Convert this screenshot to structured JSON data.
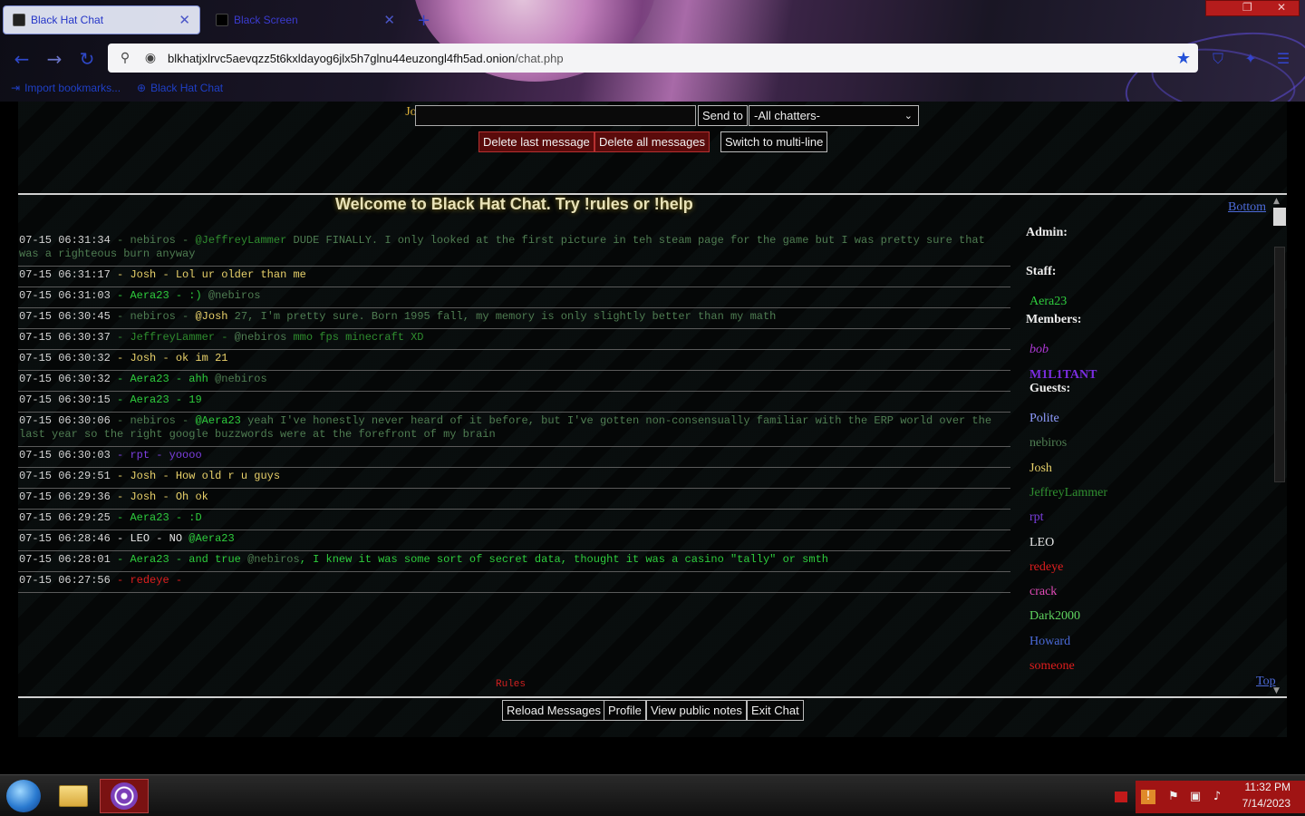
{
  "browser": {
    "tabs": [
      {
        "label": "Black Hat Chat",
        "active": true
      },
      {
        "label": "Black Screen",
        "active": false
      }
    ],
    "url": {
      "host": "blkhatjxlrvc5aevqzz5t6kxldayog6jlx5h7glnu44euzongl4fh5ad.onion",
      "path": "/chat.php"
    },
    "bookmarks": [
      "Import bookmarks...",
      "Black Hat Chat"
    ]
  },
  "chat_form": {
    "nickname": "Josh",
    "send_label": "Send to",
    "recipient": "-All chatters-",
    "delete_last_label": "Delete last message",
    "delete_all_label": "Delete all messages",
    "multiline_label": "Switch to multi-line"
  },
  "welcome": "Welcome to Black Hat Chat. Try !rules or !help",
  "nav": {
    "bottom": "Bottom",
    "top": "Top",
    "rules": "Rules"
  },
  "colors": {
    "nebiros": "#4f7d52",
    "Josh": "#e8d16a",
    "Aera23": "#2ecc3d",
    "JeffreyLammer": "#2f8d2f",
    "rpt": "#7c3fe0",
    "LEO": "#e6e6e6",
    "redeye": "#e01e1e"
  },
  "messages": [
    {
      "time": "07-15 06:31:34",
      "user": "nebiros",
      "segments": [
        {
          "t": "@JeffreyLammer",
          "c": "JeffreyLammer"
        },
        {
          "t": " DUDE FINALLY. I only looked at the first picture in teh steam page for the game but I was pretty sure that was a righteous burn anyway",
          "c": "nebiros"
        }
      ]
    },
    {
      "time": "07-15 06:31:17",
      "user": "Josh",
      "segments": [
        {
          "t": "Lol ur older than me",
          "c": "Josh"
        }
      ]
    },
    {
      "time": "07-15 06:31:03",
      "user": "Aera23",
      "segments": [
        {
          "t": ":) ",
          "c": "Aera23"
        },
        {
          "t": "@nebiros",
          "c": "nebiros"
        }
      ]
    },
    {
      "time": "07-15 06:30:45",
      "user": "nebiros",
      "segments": [
        {
          "t": "@Josh",
          "c": "Josh"
        },
        {
          "t": " 27, I'm pretty sure. Born 1995 fall, my memory is only slightly better than my math",
          "c": "nebiros"
        }
      ]
    },
    {
      "time": "07-15 06:30:37",
      "user": "JeffreyLammer",
      "segments": [
        {
          "t": "@nebiros",
          "c": "nebiros"
        },
        {
          "t": " mmo fps minecraft XD",
          "c": "JeffreyLammer"
        }
      ]
    },
    {
      "time": "07-15 06:30:32",
      "user": "Josh",
      "segments": [
        {
          "t": "ok im 21",
          "c": "Josh"
        }
      ]
    },
    {
      "time": "07-15 06:30:32",
      "user": "Aera23",
      "segments": [
        {
          "t": "ahh ",
          "c": "Aera23"
        },
        {
          "t": "@nebiros",
          "c": "nebiros"
        }
      ]
    },
    {
      "time": "07-15 06:30:15",
      "user": "Aera23",
      "segments": [
        {
          "t": "19",
          "c": "Aera23"
        }
      ]
    },
    {
      "time": "07-15 06:30:06",
      "user": "nebiros",
      "segments": [
        {
          "t": "@Aera23",
          "c": "Aera23"
        },
        {
          "t": " yeah I've honestly never heard of it before, but I've gotten non-consensually familiar with the ERP world over the last year so the right google buzzwords were at the forefront of my brain",
          "c": "nebiros"
        }
      ]
    },
    {
      "time": "07-15 06:30:03",
      "user": "rpt",
      "segments": [
        {
          "t": "yoooo",
          "c": "rpt"
        }
      ]
    },
    {
      "time": "07-15 06:29:51",
      "user": "Josh",
      "segments": [
        {
          "t": "How old r u guys",
          "c": "Josh"
        }
      ]
    },
    {
      "time": "07-15 06:29:36",
      "user": "Josh",
      "segments": [
        {
          "t": "Oh ok",
          "c": "Josh"
        }
      ]
    },
    {
      "time": "07-15 06:29:25",
      "user": "Aera23",
      "segments": [
        {
          "t": ":D",
          "c": "Aera23"
        }
      ]
    },
    {
      "time": "07-15 06:28:46",
      "user": "LEO",
      "segments": [
        {
          "t": "NO ",
          "c": "LEO"
        },
        {
          "t": "@Aera23",
          "c": "Aera23"
        }
      ]
    },
    {
      "time": "07-15 06:28:01",
      "user": "Aera23",
      "segments": [
        {
          "t": "and true ",
          "c": "Aera23"
        },
        {
          "t": "@nebiros",
          "c": "nebiros"
        },
        {
          "t": ", I knew it was some sort of secret data, thought it was a casino \"tally\" or smth",
          "c": "Aera23"
        }
      ]
    },
    {
      "time": "07-15 06:27:56",
      "user": "redeye",
      "segments": [
        {
          "t": "",
          "c": "redeye"
        }
      ]
    }
  ],
  "userlist": {
    "admin_label": "Admin:",
    "staff_label": "Staff:",
    "members_label": "Members:",
    "guests_label": "Guests:",
    "staff": [
      {
        "name": "Aera23",
        "color": "#2ecc3d"
      }
    ],
    "members": [
      {
        "name": "bob",
        "color": "#b03ad8",
        "style": "italic"
      },
      {
        "name": "M1L1TANT",
        "color": "#7a2de0",
        "style": "bold"
      }
    ],
    "guests": [
      {
        "name": "Polite",
        "color": "#8f9cff"
      },
      {
        "name": "nebiros",
        "color": "#4f7d52"
      },
      {
        "name": "Josh",
        "color": "#e8d16a"
      },
      {
        "name": "JeffreyLammer",
        "color": "#2f8d2f"
      },
      {
        "name": "rpt",
        "color": "#7c3fe0"
      },
      {
        "name": "LEO",
        "color": "#e6e6e6"
      },
      {
        "name": "redeye",
        "color": "#e01e1e"
      },
      {
        "name": "crack",
        "color": "#e24bb8"
      },
      {
        "name": "Dark2000",
        "color": "#5fd35f"
      },
      {
        "name": "Howard",
        "color": "#4a6ad8"
      },
      {
        "name": "someone",
        "color": "#e01e1e"
      }
    ]
  },
  "footer_buttons": [
    "Reload Messages",
    "Profile",
    "View public notes",
    "Exit Chat"
  ],
  "taskbar": {
    "time": "11:32 PM",
    "date": "7/14/2023"
  }
}
